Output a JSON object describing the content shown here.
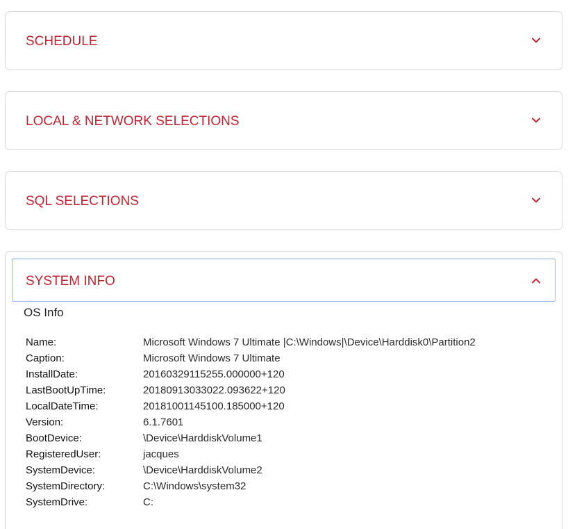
{
  "panels": [
    {
      "title": "SCHEDULE",
      "expanded": false
    },
    {
      "title": "LOCAL & NETWORK SELECTIONS",
      "expanded": false
    },
    {
      "title": "SQL SELECTIONS",
      "expanded": false
    },
    {
      "title": "SYSTEM INFO",
      "expanded": true
    }
  ],
  "icons": {
    "collapsed": "chevron-down-icon",
    "expanded": "chevron-up-icon"
  },
  "colors": {
    "accent": "#c62332",
    "focus_border": "#8fb0e8",
    "panel_border": "#d8d8d8"
  },
  "system_info": {
    "section_title": "OS Info",
    "rows": [
      {
        "key": "Name:",
        "value": "Microsoft Windows 7 Ultimate |C:\\Windows|\\Device\\Harddisk0\\Partition2"
      },
      {
        "key": "Caption:",
        "value": "Microsoft Windows 7 Ultimate"
      },
      {
        "key": "InstallDate:",
        "value": "20160329115255.000000+120"
      },
      {
        "key": "LastBootUpTime:",
        "value": "20180913033022.093622+120"
      },
      {
        "key": "LocalDateTime:",
        "value": "20181001145100.185000+120"
      },
      {
        "key": "Version:",
        "value": "6.1.7601"
      },
      {
        "key": "BootDevice:",
        "value": "\\Device\\HarddiskVolume1"
      },
      {
        "key": "RegisteredUser:",
        "value": "jacques"
      },
      {
        "key": "SystemDevice:",
        "value": "\\Device\\HarddiskVolume2"
      },
      {
        "key": "SystemDirectory:",
        "value": "C:\\Windows\\system32"
      },
      {
        "key": "SystemDrive:",
        "value": "C:"
      }
    ]
  }
}
